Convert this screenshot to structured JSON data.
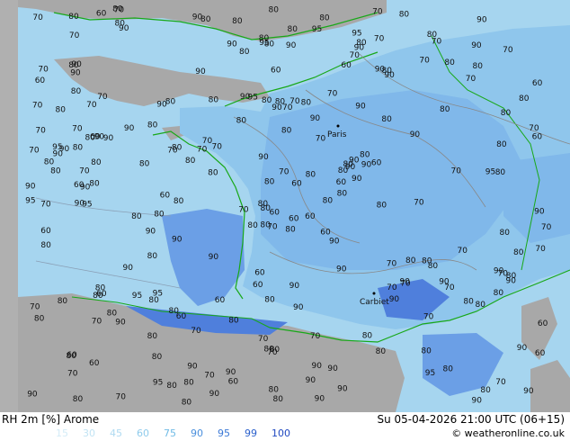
{
  "footer": {
    "title": "RH 2m [%] Arome",
    "timestamp": "Su 05-04-2026 21:00 UTC (06+15)",
    "credit": "© weatheronline.co.uk"
  },
  "legend": {
    "values": [
      "15",
      "30",
      "45",
      "60",
      "75",
      "90",
      "95",
      "99",
      "100"
    ],
    "colors": [
      "#d4ecf7",
      "#c2e4f4",
      "#afdaf1",
      "#8fcbec",
      "#6fbbe6",
      "#4a8fdd",
      "#3a78d6",
      "#2b60cc",
      "#1f48c0"
    ]
  },
  "map": {
    "colors": {
      "land_gray": "#a8a8a8",
      "sea": "#a6d5ef",
      "rh_60": "#9fd1ee",
      "rh_70": "#8fc6ec",
      "rh_80": "#80b8ea",
      "rh_90": "#6b9fe6",
      "rh_95": "#4f7fdc",
      "coast": "#18a818",
      "isoline": "#888888"
    },
    "city_labels": [
      "Paris",
      "Carbiet"
    ],
    "contour_labels": [
      "80",
      "70",
      "80",
      "60",
      "80",
      "60",
      "70",
      "70",
      "80",
      "80",
      "90",
      "90",
      "80",
      "60",
      "80",
      "80",
      "70",
      "80",
      "70",
      "80",
      "70",
      "70",
      "80",
      "80",
      "90",
      "80",
      "70",
      "80",
      "80",
      "70",
      "60",
      "80",
      "70",
      "80",
      "80",
      "70",
      "80",
      "80",
      "90",
      "80",
      "80",
      "70",
      "80",
      "90",
      "80",
      "70",
      "60",
      "80",
      "70",
      "80",
      "70",
      "80",
      "70",
      "70",
      "80",
      "80",
      "80",
      "80",
      "70",
      "80",
      "80",
      "80",
      "90",
      "80",
      "80",
      "80",
      "80",
      "80",
      "70",
      "70",
      "80",
      "70",
      "80",
      "70",
      "80",
      "70",
      "90",
      "80",
      "90",
      "90",
      "80",
      "60",
      "80",
      "80",
      "80",
      "80",
      "90",
      "80",
      "90",
      "80",
      "80",
      "70",
      "60",
      "70",
      "60",
      "80",
      "90",
      "80",
      "90",
      "90",
      "80",
      "90",
      "90",
      "80",
      "90",
      "80",
      "90",
      "80",
      "70",
      "80",
      "80",
      "90",
      "70",
      "70",
      "80",
      "80",
      "70",
      "70",
      "90",
      "80",
      "80",
      "90",
      "90",
      "80",
      "70",
      "80",
      "70",
      "60",
      "70",
      "80",
      "60",
      "90",
      "80",
      "90",
      "80",
      "70",
      "90",
      "80",
      "70",
      "70",
      "60",
      "80",
      "80",
      "60",
      "90",
      "90",
      "90",
      "95",
      "80",
      "95",
      "80",
      "90",
      "95",
      "90",
      "70",
      "95",
      "60",
      "80",
      "80",
      "70",
      "90",
      "90",
      "95",
      "80",
      "90",
      "70",
      "60",
      "60",
      "70",
      "90",
      "80",
      "90",
      "70",
      "95",
      "80",
      "80",
      "60",
      "70",
      "70",
      "60",
      "80",
      "60",
      "90",
      "80",
      "80",
      "90",
      "80",
      "70",
      "70",
      "60",
      "70",
      "60",
      "90",
      "80",
      "90",
      "80",
      "95",
      "95",
      "90",
      "95",
      "90",
      "80",
      "80",
      "90",
      "90",
      "70",
      "80",
      "80",
      "60",
      "70",
      "60",
      "80",
      "80",
      "90",
      "95",
      "80",
      "90",
      "90",
      "90",
      "60",
      "90",
      "80",
      "90",
      "90",
      "95",
      "95",
      "90",
      "90",
      "60",
      "80",
      "70",
      "60",
      "80",
      "70",
      "90",
      "70",
      "60",
      "90",
      "60",
      "90",
      "70",
      "90",
      "80",
      "90",
      "90"
    ]
  }
}
